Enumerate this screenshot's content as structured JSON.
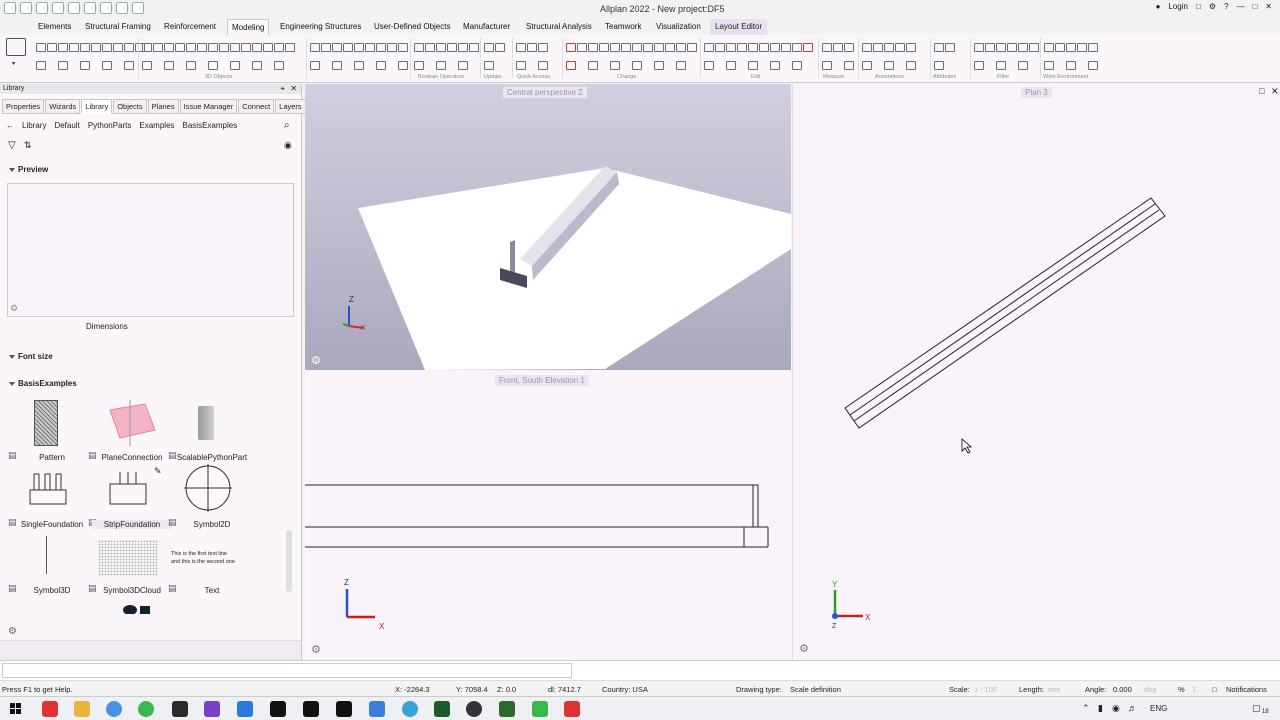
{
  "window": {
    "title": "Allplan 2022 - New project:DF5",
    "login_label": "Login"
  },
  "menu": {
    "tabs": [
      "Elements",
      "Structural Framing",
      "Reinforcement",
      "Modeling",
      "Engineering Structures",
      "User-Defined Objects",
      "Manufacturer",
      "Structural Analysis",
      "Teamwork",
      "Visualization",
      "Layout Editor"
    ],
    "active": "Modeling"
  },
  "ribbon": {
    "groups": [
      "3D Objects",
      "Boolean Operators",
      "Update",
      "Quick Access",
      "Change",
      "Edit",
      "Measure",
      "Annotations",
      "Attributes",
      "Filter",
      "Work Environment"
    ]
  },
  "library": {
    "panel_title": "Library",
    "tabs": [
      "Properties",
      "Wizards",
      "Library",
      "Objects",
      "Planes",
      "Issue Manager",
      "Connect",
      "Layers"
    ],
    "active_tab": "Library",
    "breadcrumb": [
      "Library",
      "Default",
      "PythonParts",
      "Examples",
      "BasisExamples"
    ],
    "preview_label": "Preview",
    "dimensions_label": "Dimensions",
    "font_size_label": "Font size",
    "basis_label": "BasisExamples",
    "items": [
      {
        "name": "Pattern"
      },
      {
        "name": "PlaneConnection"
      },
      {
        "name": "ScalablePythonPart"
      },
      {
        "name": "SingleFoundation"
      },
      {
        "name": "StripFoundation"
      },
      {
        "name": "Symbol2D"
      },
      {
        "name": "Symbol3D"
      },
      {
        "name": "Symbol3DCloud"
      },
      {
        "name": "Text"
      }
    ],
    "text_preview": [
      "This is the first text line",
      "and this is the second one"
    ]
  },
  "viewports": {
    "perspective": "Central perspective 2",
    "plan": "Plan 3",
    "front": "Front, South Elevation 1"
  },
  "status": {
    "help": "Press F1 to get Help.",
    "x": "X:  -2264.3",
    "y": "Y:  7058.4",
    "z": "Z:  0.0",
    "dl": "dl:  7412.7",
    "country": "Country:  USA",
    "drawing_type_label": "Drawing type:",
    "drawing_type": "Scale definition",
    "scale_label": "Scale:",
    "scale": "1 : 100",
    "length_label": "Length:",
    "length": "mm",
    "angle_label": "Angle:",
    "angle": "0.000",
    "angle_unit": "deg",
    "percent": "%",
    "percent_val": "1",
    "notifications": "Notifications"
  },
  "taskbar": {
    "language": "ENG",
    "badge": "18"
  }
}
